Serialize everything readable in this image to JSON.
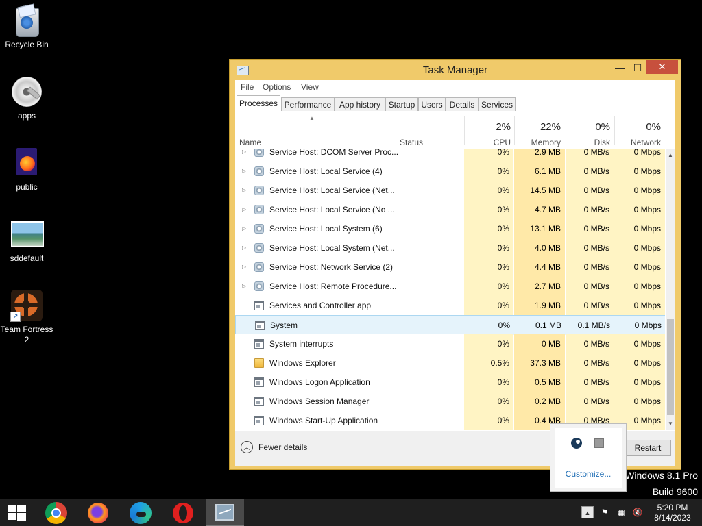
{
  "desktop": {
    "icons": [
      {
        "label": "Recycle Bin",
        "icon": "recycle-bin-icon"
      },
      {
        "label": "apps",
        "icon": "disc-icon"
      },
      {
        "label": "public",
        "icon": "firefox-file-icon"
      },
      {
        "label": "sddefault",
        "icon": "image-file-icon"
      },
      {
        "label": "Team Fortress 2",
        "icon": "team-fortress-icon"
      }
    ],
    "watermark": {
      "line1": "Windows 8.1 Pro",
      "line2": "Build 9600"
    }
  },
  "window": {
    "title": "Task Manager",
    "controls": {
      "minimize": "—",
      "maximize": "☐",
      "close": "✕"
    },
    "menu": [
      "File",
      "Options",
      "View"
    ],
    "tabs": [
      "Processes",
      "Performance",
      "App history",
      "Startup",
      "Users",
      "Details",
      "Services"
    ],
    "active_tab": "Processes",
    "columns": {
      "name": "Name",
      "status": "Status",
      "cpu": {
        "pct": "2%",
        "label": "CPU"
      },
      "memory": {
        "pct": "22%",
        "label": "Memory"
      },
      "disk": {
        "pct": "0%",
        "label": "Disk"
      },
      "network": {
        "pct": "0%",
        "label": "Network"
      }
    },
    "processes": [
      {
        "name": "Service Host: DCOM Server Proc...",
        "icon": "gear",
        "expandable": true,
        "cpu": "0%",
        "memory": "2.9 MB",
        "disk": "0 MB/s",
        "network": "0 Mbps"
      },
      {
        "name": "Service Host: Local Service (4)",
        "icon": "gear",
        "expandable": true,
        "cpu": "0%",
        "memory": "6.1 MB",
        "disk": "0 MB/s",
        "network": "0 Mbps"
      },
      {
        "name": "Service Host: Local Service (Net...",
        "icon": "gear",
        "expandable": true,
        "cpu": "0%",
        "memory": "14.5 MB",
        "disk": "0 MB/s",
        "network": "0 Mbps"
      },
      {
        "name": "Service Host: Local Service (No ...",
        "icon": "gear",
        "expandable": true,
        "cpu": "0%",
        "memory": "4.7 MB",
        "disk": "0 MB/s",
        "network": "0 Mbps"
      },
      {
        "name": "Service Host: Local System (6)",
        "icon": "gear",
        "expandable": true,
        "cpu": "0%",
        "memory": "13.1 MB",
        "disk": "0 MB/s",
        "network": "0 Mbps"
      },
      {
        "name": "Service Host: Local System (Net...",
        "icon": "gear",
        "expandable": true,
        "cpu": "0%",
        "memory": "4.0 MB",
        "disk": "0 MB/s",
        "network": "0 Mbps"
      },
      {
        "name": "Service Host: Network Service (2)",
        "icon": "gear",
        "expandable": true,
        "cpu": "0%",
        "memory": "4.4 MB",
        "disk": "0 MB/s",
        "network": "0 Mbps"
      },
      {
        "name": "Service Host: Remote Procedure...",
        "icon": "gear",
        "expandable": true,
        "cpu": "0%",
        "memory": "2.7 MB",
        "disk": "0 MB/s",
        "network": "0 Mbps"
      },
      {
        "name": "Services and Controller app",
        "icon": "win",
        "expandable": false,
        "cpu": "0%",
        "memory": "1.9 MB",
        "disk": "0 MB/s",
        "network": "0 Mbps"
      },
      {
        "name": "System",
        "icon": "win",
        "expandable": false,
        "selected": true,
        "cpu": "0%",
        "memory": "0.1 MB",
        "disk": "0.1 MB/s",
        "network": "0 Mbps"
      },
      {
        "name": "System interrupts",
        "icon": "win",
        "expandable": false,
        "cpu": "0%",
        "memory": "0 MB",
        "disk": "0 MB/s",
        "network": "0 Mbps"
      },
      {
        "name": "Windows Explorer",
        "icon": "folder",
        "expandable": false,
        "highlight": true,
        "cpu": "0.5%",
        "memory": "37.3 MB",
        "disk": "0 MB/s",
        "network": "0 Mbps"
      },
      {
        "name": "Windows Logon Application",
        "icon": "win",
        "expandable": false,
        "cpu": "0%",
        "memory": "0.5 MB",
        "disk": "0 MB/s",
        "network": "0 Mbps"
      },
      {
        "name": "Windows Session Manager",
        "icon": "win",
        "expandable": false,
        "cpu": "0%",
        "memory": "0.2 MB",
        "disk": "0 MB/s",
        "network": "0 Mbps"
      },
      {
        "name": "Windows Start-Up Application",
        "icon": "win",
        "expandable": false,
        "cpu": "0%",
        "memory": "0.4 MB",
        "disk": "0 MB/s",
        "network": "0 Mbps"
      }
    ],
    "footer": {
      "fewer_details": "Fewer details",
      "restart": "Restart"
    }
  },
  "tray_popup": {
    "customize": "Customize..."
  },
  "taskbar": {
    "apps": [
      "chrome-icon",
      "firefox-icon",
      "edge-icon",
      "opera-icon",
      "task-manager-icon"
    ],
    "clock": {
      "time": "5:20 PM",
      "date": "8/14/2023"
    }
  },
  "colors": {
    "window_frame": "#f0ca6a",
    "close_button": "#c7503d",
    "heat_light": "#fff4c4",
    "heat_mem": "#ffe9a8",
    "selection": "#e5f3fb"
  }
}
